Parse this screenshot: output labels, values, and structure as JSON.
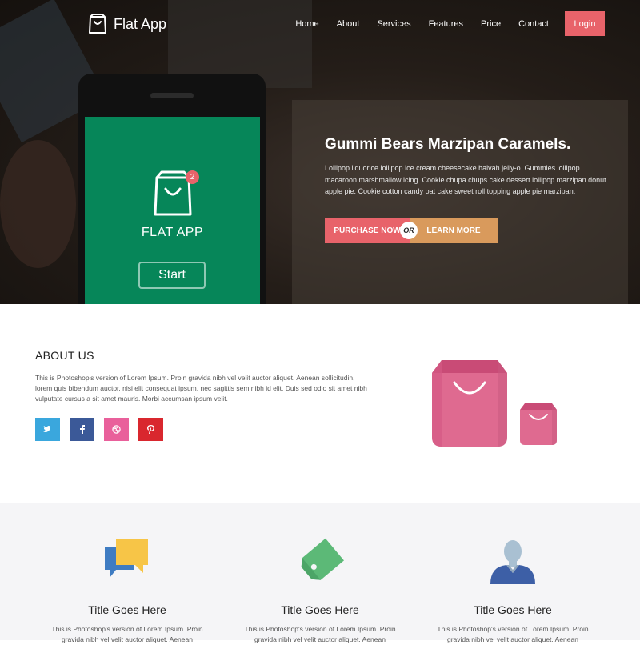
{
  "brand": {
    "name": "Flat App"
  },
  "nav": {
    "items": [
      "Home",
      "About",
      "Services",
      "Features",
      "Price",
      "Contact"
    ],
    "login": "Login"
  },
  "phone": {
    "badge": "2",
    "app_name": "FLAT APP",
    "start": "Start"
  },
  "hero": {
    "title": "Gummi Bears Marzipan Caramels.",
    "text": "Lollipop liquorice lollipop ice cream cheesecake halvah jelly-o. Gummies lollipop macaroon marshmallow icing. Cookie chupa chups cake dessert lollipop marzipan donut apple pie. Cookie cotton candy oat cake sweet roll topping apple pie marzipan.",
    "purchase": "PURCHASE NOW",
    "or": "OR",
    "learn": "LEARN MORE"
  },
  "about": {
    "title": "ABOUT US",
    "text": "This is Photoshop's version of Lorem Ipsum. Proin gravida nibh vel velit auctor aliquet. Aenean sollicitudin, lorem quis bibendum auctor, nisi elit consequat ipsum, nec sagittis sem nibh id elit. Duis sed odio sit amet nibh vulputate cursus a sit amet mauris. Morbi accumsan ipsum velit.",
    "social": [
      {
        "name": "twitter",
        "icon": "twitter-icon",
        "color": "#3aa7dd"
      },
      {
        "name": "facebook",
        "icon": "facebook-icon",
        "color": "#3b5998"
      },
      {
        "name": "dribbble",
        "icon": "dribbble-icon",
        "color": "#e9609b"
      },
      {
        "name": "pinterest",
        "icon": "pinterest-icon",
        "color": "#d9272e"
      }
    ]
  },
  "features": [
    {
      "icon": "chat-bubbles-icon",
      "title": "Title Goes Here",
      "text": "This is Photoshop's version of Lorem Ipsum. Proin gravida nibh vel velit auctor aliquet. Aenean"
    },
    {
      "icon": "price-tag-icon",
      "title": "Title Goes Here",
      "text": "This is Photoshop's version of Lorem Ipsum. Proin gravida nibh vel velit auctor aliquet. Aenean"
    },
    {
      "icon": "user-icon",
      "title": "Title Goes Here",
      "text": "This is Photoshop's version of Lorem Ipsum. Proin gravida nibh vel velit auctor aliquet. Aenean"
    }
  ],
  "colors": {
    "accent": "#e8636a",
    "learn_more": "#d99a5c",
    "phone_screen": "#068659",
    "bag_pink": "#df6a90"
  }
}
